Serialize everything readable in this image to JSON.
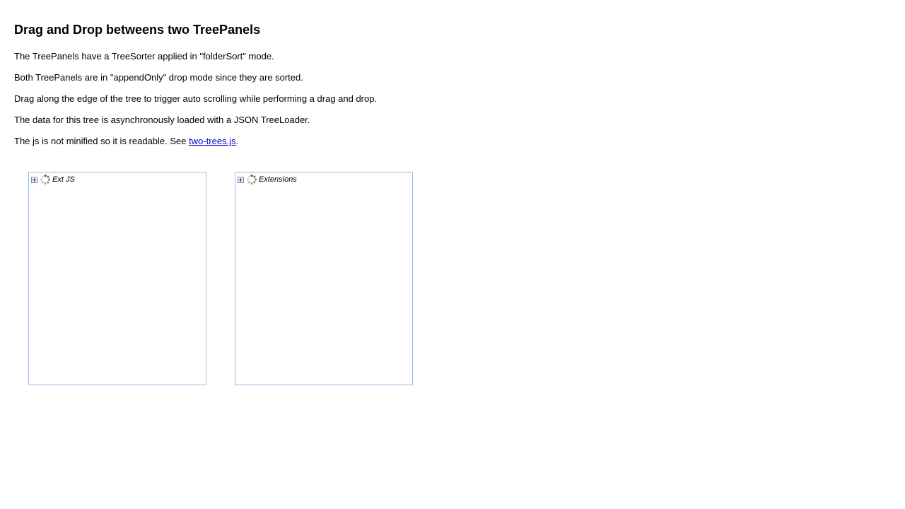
{
  "page": {
    "title": "Drag and Drop betweens two TreePanels",
    "paragraphs": [
      "The TreePanels have a TreeSorter applied in \"folderSort\" mode.",
      "Both TreePanels are in \"appendOnly\" drop mode since they are sorted.",
      "Drag along the edge of the tree to trigger auto scrolling while performing a drag and drop.",
      "The data for this tree is asynchronously loaded with a JSON TreeLoader."
    ],
    "source_note": {
      "prefix": "The js is not minified so it is readable. See ",
      "link_text": "two-trees.js",
      "suffix": "."
    }
  },
  "trees": {
    "left": {
      "root_label": "Ext JS",
      "expander_icon": "plus-expander-icon",
      "node_icon": "loading-spinner-icon"
    },
    "right": {
      "root_label": "Extensions",
      "expander_icon": "plus-expander-icon",
      "node_icon": "loading-spinner-icon"
    }
  },
  "colors": {
    "panel_border": "#99bbe8",
    "link": "#0000cc"
  }
}
